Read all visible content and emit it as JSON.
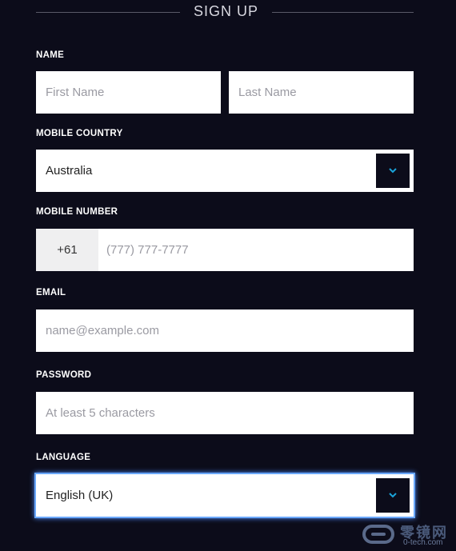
{
  "header": {
    "title": "SIGN UP"
  },
  "name": {
    "label": "NAME",
    "first_placeholder": "First Name",
    "last_placeholder": "Last Name"
  },
  "mobile_country": {
    "label": "MOBILE COUNTRY",
    "value": "Australia",
    "icon": "chevron-down-icon"
  },
  "mobile_number": {
    "label": "MOBILE NUMBER",
    "prefix": "+61",
    "placeholder": "(777) 777-7777"
  },
  "email": {
    "label": "EMAIL",
    "placeholder": "name@example.com"
  },
  "password": {
    "label": "PASSWORD",
    "placeholder": "At least 5 characters"
  },
  "language": {
    "label": "LANGUAGE",
    "value": "English (UK)",
    "icon": "chevron-down-icon",
    "focused": true
  },
  "watermark": {
    "brand": "零镜网",
    "url": "0-tech.com"
  },
  "colors": {
    "background": "#0c0c1a",
    "accent": "#1aa3d9",
    "focus": "#4f8fff"
  }
}
